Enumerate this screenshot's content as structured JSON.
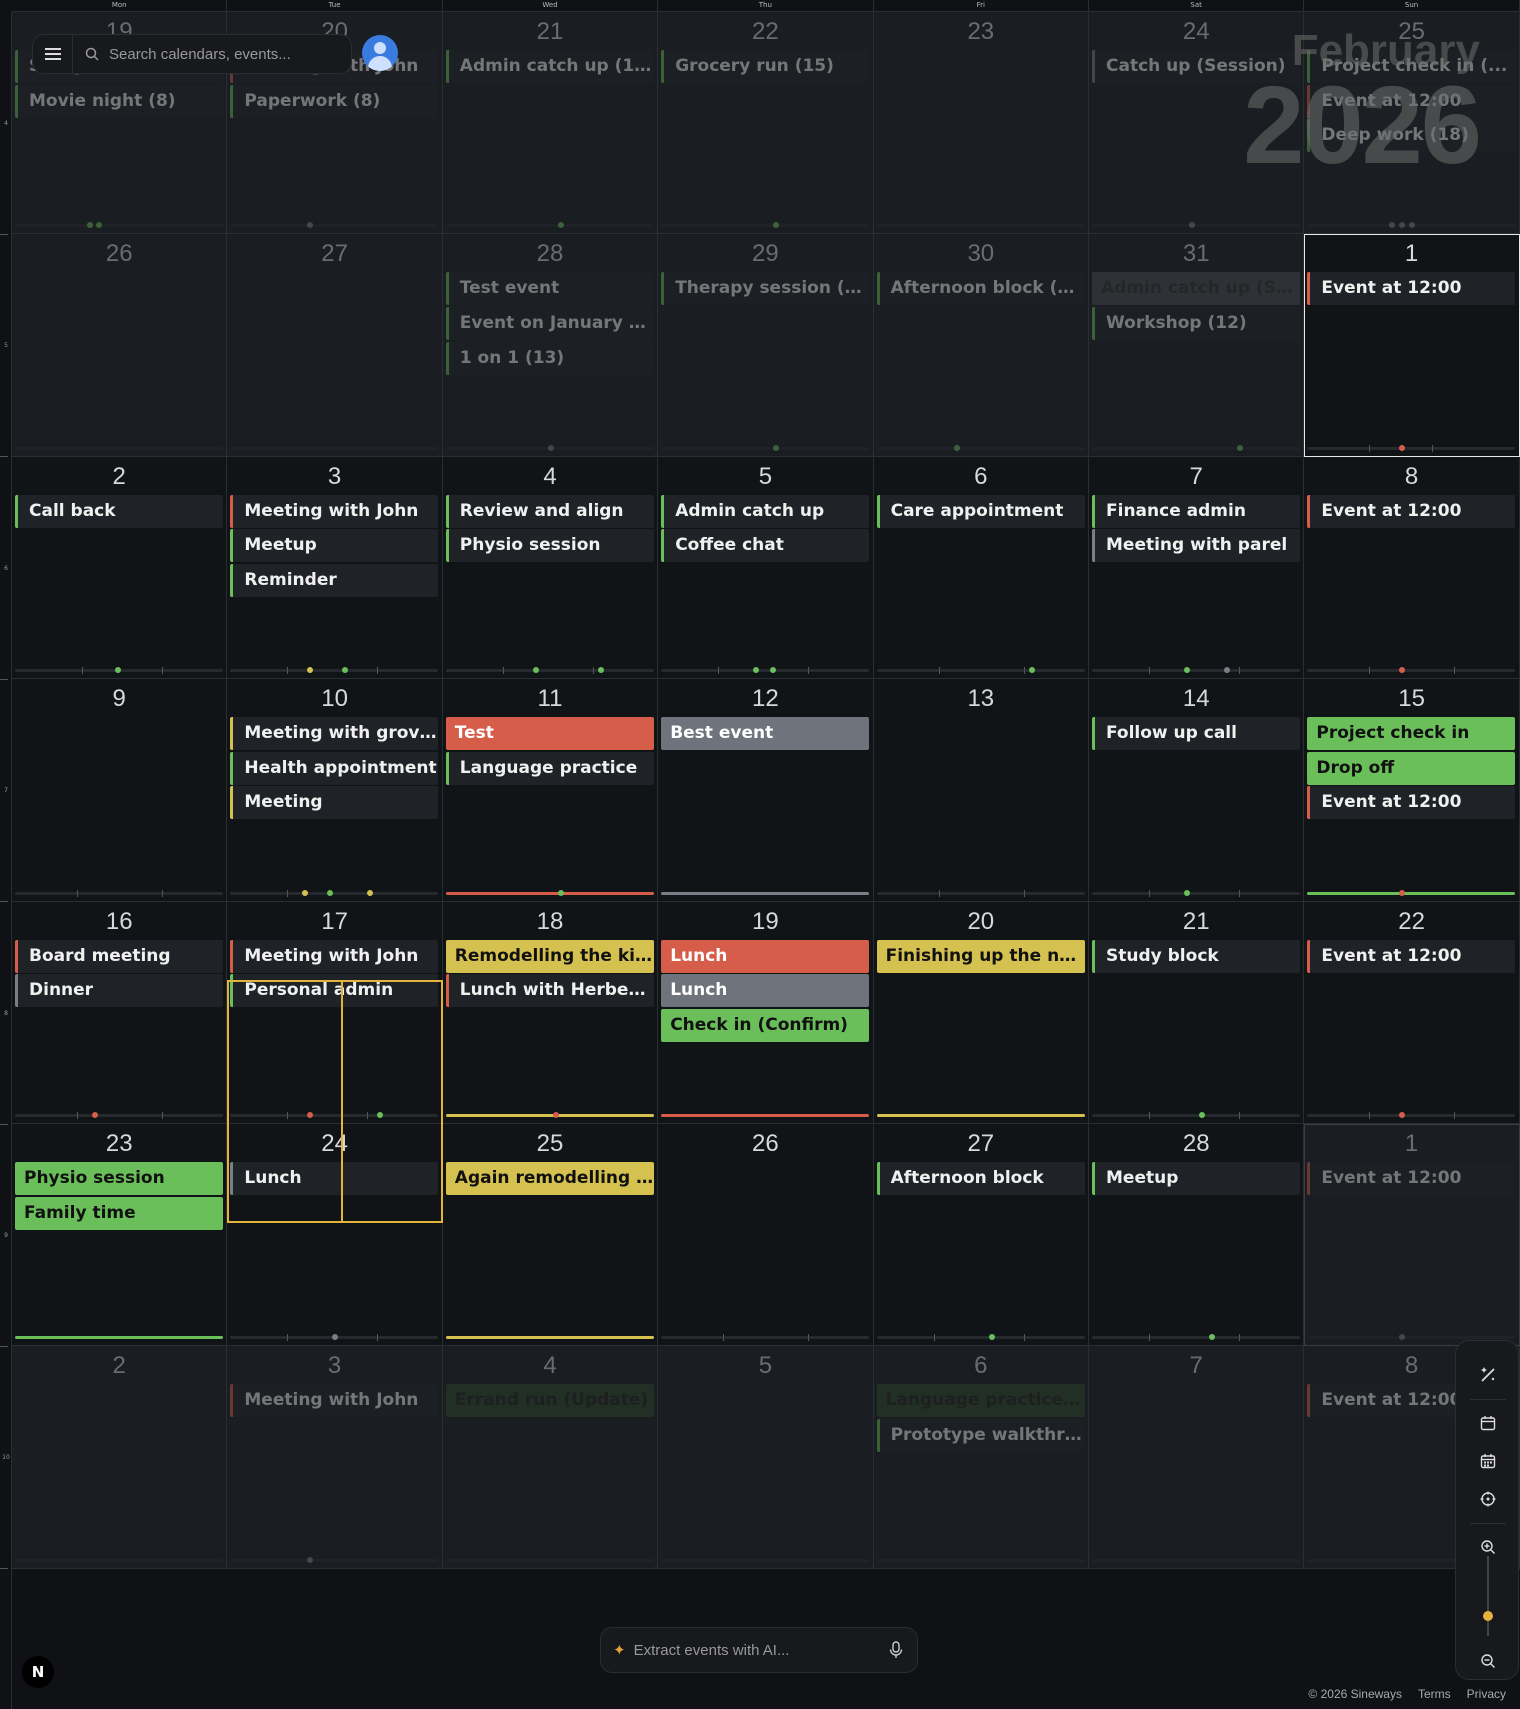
{
  "dow": [
    "Mon",
    "Tue",
    "Wed",
    "Thu",
    "Fri",
    "Sat",
    "Sun"
  ],
  "week_numbers": [
    "4",
    "5",
    "6",
    "7",
    "8",
    "9",
    "10"
  ],
  "search": {
    "placeholder": "Search calendars, events..."
  },
  "title": {
    "month": "February",
    "year": "2026"
  },
  "ai": {
    "placeholder": "Extract events with AI..."
  },
  "footer": {
    "copyright": "© 2026 Sineways",
    "terms": "Terms",
    "privacy": "Privacy"
  },
  "logo": "N",
  "colors": {
    "green": "#6abf5b",
    "red": "#d75d4b",
    "yellow": "#d5c14f",
    "gray": "#7a7f87",
    "accent": "#e3b33b"
  },
  "weeks": [
    [
      {
        "n": "19",
        "muted": true,
        "events": [
          {
            "t": "Study session",
            "s": "b-green"
          },
          {
            "t": "Movie night (8)",
            "s": "b-green"
          }
        ]
      },
      {
        "n": "20",
        "muted": true,
        "events": [
          {
            "t": "Meeting with John",
            "s": "b-red"
          },
          {
            "t": "Paperwork (8)",
            "s": "b-green"
          }
        ]
      },
      {
        "n": "21",
        "muted": true,
        "events": [
          {
            "t": "Admin catch up (12)",
            "s": "b-green"
          }
        ]
      },
      {
        "n": "22",
        "muted": true,
        "events": [
          {
            "t": "Grocery run (15)",
            "s": "b-green"
          }
        ]
      },
      {
        "n": "23",
        "muted": true,
        "events": []
      },
      {
        "n": "24",
        "muted": true,
        "events": [
          {
            "t": "Catch up (Session)",
            "s": "b-gray"
          }
        ]
      },
      {
        "n": "25",
        "muted": true,
        "events": [
          {
            "t": "Project check in (...",
            "s": "b-green"
          },
          {
            "t": "Event at 12:00",
            "s": "b-red"
          },
          {
            "t": "Deep work (18)",
            "s": "b-green"
          }
        ]
      }
    ],
    [
      {
        "n": "26",
        "muted": true,
        "events": []
      },
      {
        "n": "27",
        "muted": true,
        "events": []
      },
      {
        "n": "28",
        "muted": true,
        "events": [
          {
            "t": "Test event",
            "s": "b-green"
          },
          {
            "t": "Event on January 2...",
            "s": "b-green"
          },
          {
            "t": "1 on 1 (13)",
            "s": "b-green"
          }
        ]
      },
      {
        "n": "29",
        "muted": true,
        "events": [
          {
            "t": "Therapy session (1...",
            "s": "b-green"
          }
        ]
      },
      {
        "n": "30",
        "muted": true,
        "events": [
          {
            "t": "Afternoon block (1...",
            "s": "b-green"
          }
        ]
      },
      {
        "n": "31",
        "muted": true,
        "events": [
          {
            "t": "Admin catch up (Ses...",
            "s": "f-dkgray"
          },
          {
            "t": "Workshop (12)",
            "s": "b-green"
          }
        ]
      },
      {
        "n": "1",
        "muted": false,
        "sel": true,
        "events": [
          {
            "t": "Event at 12:00",
            "s": "b-red"
          }
        ]
      }
    ],
    [
      {
        "n": "2",
        "events": [
          {
            "t": "Call back",
            "s": "b-green"
          }
        ]
      },
      {
        "n": "3",
        "events": [
          {
            "t": "Meeting with John",
            "s": "b-red"
          },
          {
            "t": "Meetup",
            "s": "b-green"
          },
          {
            "t": "Reminder",
            "s": "b-green"
          }
        ]
      },
      {
        "n": "4",
        "events": [
          {
            "t": "Review and align",
            "s": "b-green"
          },
          {
            "t": "Physio session",
            "s": "b-green"
          }
        ]
      },
      {
        "n": "5",
        "events": [
          {
            "t": "Admin catch up",
            "s": "b-green"
          },
          {
            "t": "Coffee chat",
            "s": "b-green"
          }
        ]
      },
      {
        "n": "6",
        "events": [
          {
            "t": "Care appointment",
            "s": "b-green"
          }
        ]
      },
      {
        "n": "7",
        "events": [
          {
            "t": "Finance admin",
            "s": "b-green"
          },
          {
            "t": "Meeting with parel",
            "s": "b-gray"
          }
        ]
      },
      {
        "n": "8",
        "events": [
          {
            "t": "Event at 12:00",
            "s": "b-red"
          }
        ]
      }
    ],
    [
      {
        "n": "9",
        "events": []
      },
      {
        "n": "10",
        "events": [
          {
            "t": "Meeting with grove...",
            "s": "b-yellow"
          },
          {
            "t": "Health appointment",
            "s": "b-green"
          },
          {
            "t": "Meeting",
            "s": "b-yellow"
          }
        ]
      },
      {
        "n": "11",
        "events": [
          {
            "t": "Test",
            "s": "f-red"
          },
          {
            "t": "Language practice",
            "s": "b-green"
          }
        ]
      },
      {
        "n": "12",
        "events": [
          {
            "t": "Best event",
            "s": "f-gray"
          }
        ]
      },
      {
        "n": "13",
        "events": []
      },
      {
        "n": "14",
        "events": [
          {
            "t": "Follow up call",
            "s": "b-green"
          }
        ]
      },
      {
        "n": "15",
        "events": [
          {
            "t": "Project check in",
            "s": "f-green"
          },
          {
            "t": "Drop off",
            "s": "f-green"
          },
          {
            "t": "Event at 12:00",
            "s": "b-red"
          }
        ]
      }
    ],
    [
      {
        "n": "16",
        "events": [
          {
            "t": "Board meeting",
            "s": "b-red"
          },
          {
            "t": "Dinner",
            "s": "b-gray"
          }
        ]
      },
      {
        "n": "17",
        "events": [
          {
            "t": "Meeting with John",
            "s": "b-red"
          },
          {
            "t": "Personal admin",
            "s": "b-green"
          }
        ]
      },
      {
        "n": "18",
        "events": [
          {
            "t": "Remodelling the kit...",
            "s": "f-yellow"
          },
          {
            "t": "Lunch with Herbert...",
            "s": "b-red"
          }
        ]
      },
      {
        "n": "19",
        "events": [
          {
            "t": "Lunch",
            "s": "f-red"
          },
          {
            "t": "Lunch",
            "s": "f-gray"
          },
          {
            "t": "Check in (Confirm)",
            "s": "f-green"
          }
        ]
      },
      {
        "n": "20",
        "events": [
          {
            "t": "Finishing up the ne...",
            "s": "f-yellow"
          }
        ]
      },
      {
        "n": "21",
        "events": [
          {
            "t": "Study block",
            "s": "b-green"
          }
        ]
      },
      {
        "n": "22",
        "events": [
          {
            "t": "Event at 12:00",
            "s": "b-red"
          }
        ]
      }
    ],
    [
      {
        "n": "23",
        "events": [
          {
            "t": "Physio session",
            "s": "f-green"
          },
          {
            "t": "Family time",
            "s": "f-green"
          }
        ]
      },
      {
        "n": "24",
        "events": [
          {
            "t": "Lunch",
            "s": "b-gray"
          }
        ]
      },
      {
        "n": "25",
        "events": [
          {
            "t": "Again remodelling t...",
            "s": "f-yellow"
          }
        ]
      },
      {
        "n": "26",
        "events": []
      },
      {
        "n": "27",
        "events": [
          {
            "t": "Afternoon block",
            "s": "b-green"
          }
        ]
      },
      {
        "n": "28",
        "events": [
          {
            "t": "Meetup",
            "s": "b-green"
          }
        ]
      },
      {
        "n": "1",
        "muted": true,
        "seldim": true,
        "events": [
          {
            "t": "Event at 12:00",
            "s": "b-red"
          }
        ]
      }
    ],
    [
      {
        "n": "2",
        "muted": true,
        "events": []
      },
      {
        "n": "3",
        "muted": true,
        "events": [
          {
            "t": "Meeting with John",
            "s": "b-red"
          }
        ]
      },
      {
        "n": "4",
        "muted": true,
        "events": [
          {
            "t": "Errand run (Update)",
            "s": "f-dkgreen"
          }
        ]
      },
      {
        "n": "5",
        "muted": true,
        "events": []
      },
      {
        "n": "6",
        "muted": true,
        "events": [
          {
            "t": "Language practice (...",
            "s": "f-dkgreen"
          },
          {
            "t": "Prototype walkthro...",
            "s": "b-green"
          }
        ]
      },
      {
        "n": "7",
        "muted": true,
        "events": []
      },
      {
        "n": "8",
        "muted": true,
        "events": [
          {
            "t": "Event at 12:00",
            "s": "b-red"
          }
        ]
      }
    ]
  ]
}
